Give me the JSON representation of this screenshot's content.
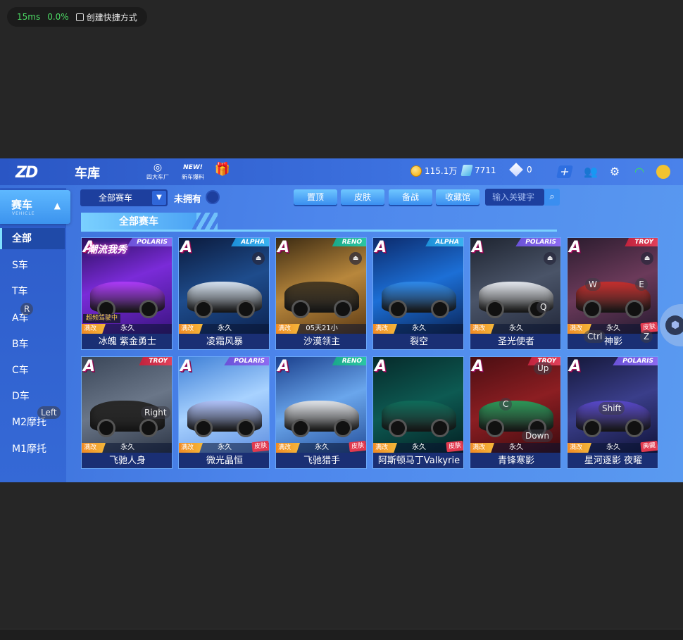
{
  "overlay": {
    "ping": "15ms",
    "loss": "0.0%",
    "shortcut_label": "创建快捷方式"
  },
  "header": {
    "logo_text": "ZD",
    "title": "车库",
    "icons": [
      {
        "name": "四大车厂",
        "glyph": "◎"
      },
      {
        "name": "新车爆料",
        "glyph": "NEW!"
      },
      {
        "name": "",
        "glyph": "🎁"
      }
    ],
    "currency": {
      "coins": "115.1万",
      "crystals": "7711",
      "diamonds": "0"
    }
  },
  "sidebar": {
    "head": {
      "label": "赛车",
      "sub": "VEHICLE"
    },
    "items": [
      {
        "label": "全部",
        "active": true
      },
      {
        "label": "S车"
      },
      {
        "label": "T车"
      },
      {
        "label": "A车"
      },
      {
        "label": "B车"
      },
      {
        "label": "C车"
      },
      {
        "label": "D车"
      },
      {
        "label": "M2摩托"
      },
      {
        "label": "M1摩托"
      }
    ]
  },
  "filters": {
    "dropdown": "全部赛车",
    "unowned_label": "未拥有",
    "buttons": [
      "置顶",
      "皮肤",
      "备战",
      "收藏馆"
    ],
    "search_placeholder": "输入关键字"
  },
  "section_title": "全部赛车",
  "cards": [
    {
      "name": "冰魄 紫金勇士",
      "grade": "A",
      "brand": "POLARIS",
      "brand_type": "polaris",
      "mod": "满改",
      "status": "永久",
      "flag": "超频驾驶中",
      "poster": "潮流我秀",
      "eject": false,
      "skin": false,
      "bg": "linear-gradient(160deg,#2b0f5c,#7a2bd8 45%,#3a1480)",
      "car": "#b03cff"
    },
    {
      "name": "凌霜风暴",
      "grade": "A",
      "brand": "ALPHA",
      "brand_type": "alpha",
      "mod": "满改",
      "status": "永久",
      "eject": true,
      "skin": false,
      "bg": "linear-gradient(160deg,#0b1a3c,#1e4c8c 50%,#0c2350)",
      "car": "#d9e6f5"
    },
    {
      "name": "沙漠领主",
      "grade": "A",
      "brand": "RENO",
      "brand_type": "reno",
      "mod": "满改",
      "status": "05天21小时",
      "eject": true,
      "skin": false,
      "bg": "linear-gradient(160deg,#3b2a12,#b8873c 50%,#5c3a15)",
      "car": "#4a3b22"
    },
    {
      "name": "裂空",
      "grade": "A",
      "brand": "ALPHA",
      "brand_type": "alpha",
      "mod": "满改",
      "status": "永久",
      "eject": false,
      "skin": false,
      "bg": "linear-gradient(160deg,#0c2a6b,#1c6fd6 50%,#0a2457)",
      "car": "#2f8cf0"
    },
    {
      "name": "圣光使者",
      "grade": "A",
      "brand": "POLARIS",
      "brand_type": "polaris",
      "mod": "满改",
      "status": "永久",
      "eject": true,
      "skin": false,
      "bg": "linear-gradient(160deg,#1e2430,#4a5468 50%,#22283a)",
      "car": "#e8ecf3"
    },
    {
      "name": "神影",
      "grade": "A",
      "brand": "TROY",
      "brand_type": "troy",
      "mod": "满改",
      "status": "永久",
      "eject": true,
      "skin": true,
      "skin_label": "皮肤",
      "bg": "linear-gradient(160deg,#2b1c2e,#6b3a5a 50%,#251a30)",
      "car": "#c8302f"
    },
    {
      "name": "飞驰人身",
      "grade": "A",
      "brand": "TROY",
      "brand_type": "troy",
      "mod": "满改",
      "status": "永久",
      "eject": false,
      "skin": false,
      "bg": "linear-gradient(160deg,#3a4658,#6a7688 50%,#2d3646)",
      "car": "#2a2a2a"
    },
    {
      "name": "微光晶恒",
      "grade": "A",
      "brand": "POLARIS",
      "brand_type": "polaris",
      "mod": "满改",
      "status": "永久",
      "eject": false,
      "skin": true,
      "skin_label": "皮肤",
      "bg": "linear-gradient(160deg,#3e7fd6,#a8d2ff 50%,#5e8ee0)",
      "car": "#b3c6ff"
    },
    {
      "name": "飞驰猎手",
      "grade": "A",
      "brand": "RENO",
      "brand_type": "reno",
      "mod": "满改",
      "status": "永久",
      "eject": false,
      "skin": true,
      "skin_label": "皮肤",
      "bg": "linear-gradient(160deg,#1a3f8c,#6aa6ec 50%,#254f9a)",
      "car": "#e6e9ee"
    },
    {
      "name": "阿斯顿马丁Valkyrie",
      "grade": "A",
      "brand": "",
      "brand_type": "",
      "mod": "满改",
      "status": "永久",
      "eject": false,
      "skin": true,
      "skin_label": "皮肤",
      "bg": "linear-gradient(160deg,#062a2a,#0d5a52 50%,#041f22)",
      "car": "#0f6e5c"
    },
    {
      "name": "青锋寒影",
      "grade": "A",
      "brand": "TROY",
      "brand_type": "troy",
      "mod": "满改",
      "status": "永久",
      "eject": false,
      "skin": false,
      "bg": "linear-gradient(160deg,#4a0e12,#8c1e22 50%,#3a0a0e)",
      "car": "#2f9a5a"
    },
    {
      "name": "星河逐影 夜曜",
      "grade": "A",
      "brand": "POLARIS",
      "brand_type": "polaris",
      "mod": "满改",
      "status": "永久",
      "eject": false,
      "skin": true,
      "skin_label": "典藏",
      "bg": "linear-gradient(160deg,#15183a,#3a3e8a 50%,#101338)",
      "car": "#5a4ad0"
    }
  ],
  "key_hints": [
    "R",
    "Left",
    "Right",
    "W",
    "E",
    "Q",
    "Ctrl",
    "Z",
    "Up",
    "C",
    "Down",
    "Shift"
  ]
}
